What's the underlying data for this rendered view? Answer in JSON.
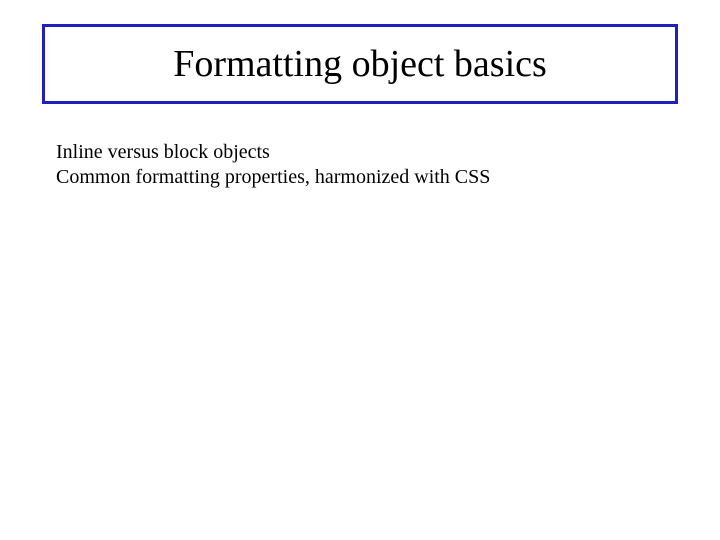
{
  "slide": {
    "title": "Formatting object basics",
    "bullets": [
      "Inline versus block objects",
      "Common formatting properties, harmonized with CSS"
    ]
  }
}
